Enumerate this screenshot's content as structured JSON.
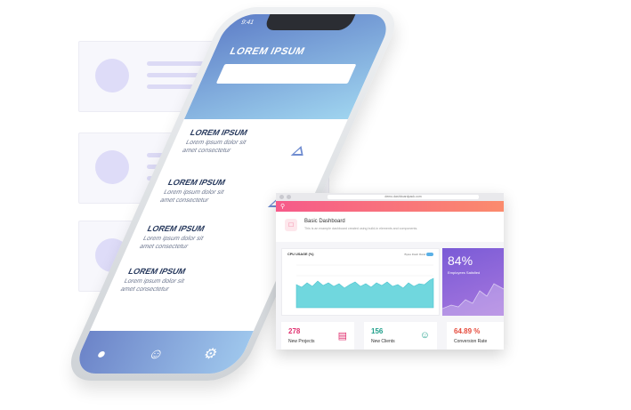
{
  "phone": {
    "time": "9:41",
    "title": "LOREM IPSUM",
    "items": [
      {
        "title": "LOREM IPSUM",
        "text": "Lorem ipsum dolor sit amet consectetur"
      },
      {
        "title": "LOREM IPSUM",
        "text": "Lorem ipsum dolor sit amet consectetur"
      },
      {
        "title": "LOREM IPSUM",
        "text": "Lorem ipsum dolor sit amet consectetur"
      },
      {
        "title": "LOREM IPSUM",
        "text": "Lorem ipsum dolor sit amet consectetur"
      }
    ],
    "tabs": [
      "pin-icon",
      "users-icon",
      "gear-icon"
    ]
  },
  "browser": {
    "url": "demo.dashboardpack.com",
    "header_title": "Basic Dashboard",
    "header_subtitle": "This is an example dashboard created using build-in elements and components.",
    "cpu_title": "CPU USAGE (%)",
    "cpu_legend": "Bytes  Flash  Rand",
    "satisfaction_value": "84%",
    "satisfaction_label": "Employees Satisfied",
    "stats": [
      {
        "value": "278",
        "label": "New Projects",
        "color": "#e0306f",
        "icon": "briefcase-icon"
      },
      {
        "value": "156",
        "label": "New Clients",
        "color": "#1f9f8a",
        "icon": "user-icon"
      },
      {
        "value": "64.89 %",
        "label": "Conversion Rate",
        "color": "#e64b3c",
        "icon": "chart-icon"
      }
    ]
  },
  "colors": {
    "accent": "#f65a8a",
    "purple": "#8c66dc",
    "teal": "#5fd3d7"
  }
}
